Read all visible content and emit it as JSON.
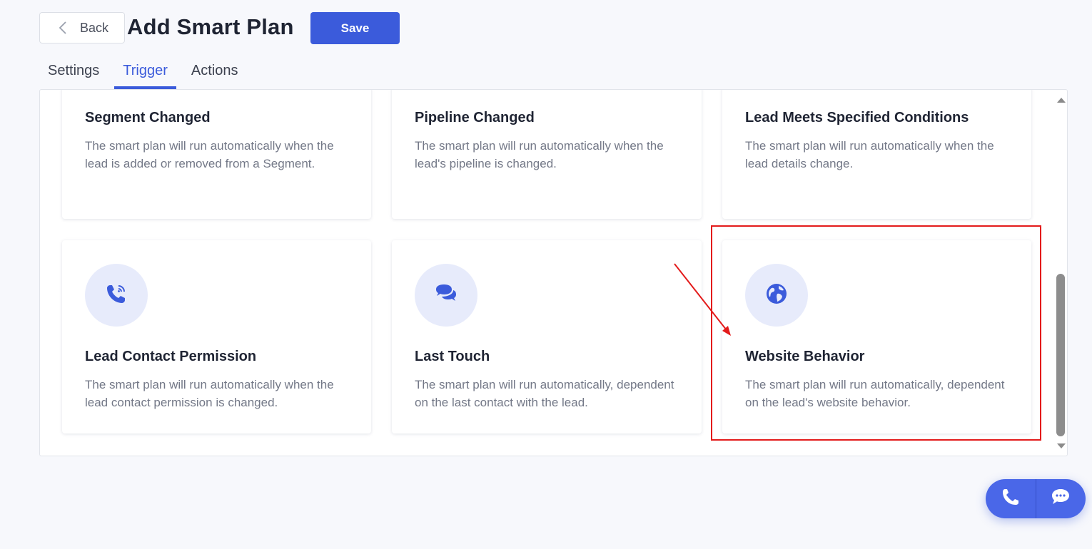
{
  "header": {
    "back_label": "Back",
    "title": "Add Smart Plan",
    "save_label": "Save"
  },
  "tabs": [
    {
      "label": "Settings",
      "active": false
    },
    {
      "label": "Trigger",
      "active": true
    },
    {
      "label": "Actions",
      "active": false
    }
  ],
  "cards": [
    {
      "title": "Segment Changed",
      "desc": "The smart plan will run automatically when the lead is added or removed from a Segment."
    },
    {
      "title": "Pipeline Changed",
      "desc": "The smart plan will run automatically when the lead's pipeline is changed."
    },
    {
      "title": "Lead Meets Specified Conditions",
      "desc": "The smart plan will run automatically when the lead details change."
    },
    {
      "title": "Lead Contact Permission",
      "desc": "The smart plan will run automatically when the lead contact permission is changed.",
      "icon": "phone-wifi-icon"
    },
    {
      "title": "Last Touch",
      "desc": "The smart plan will run automatically, dependent on the last contact with the lead.",
      "icon": "chat-bubbles-icon"
    },
    {
      "title": "Website Behavior",
      "desc": "The smart plan will run automatically, dependent on the lead's website behavior.",
      "icon": "globe-icon",
      "highlighted": true
    }
  ],
  "colors": {
    "accent": "#3b5bdb",
    "icon_bg": "#e7ebfb",
    "annotation": "#e31b1b",
    "fab": "#4a67e8"
  },
  "fab": {
    "icons": [
      "phone-icon",
      "chat-icon"
    ]
  }
}
